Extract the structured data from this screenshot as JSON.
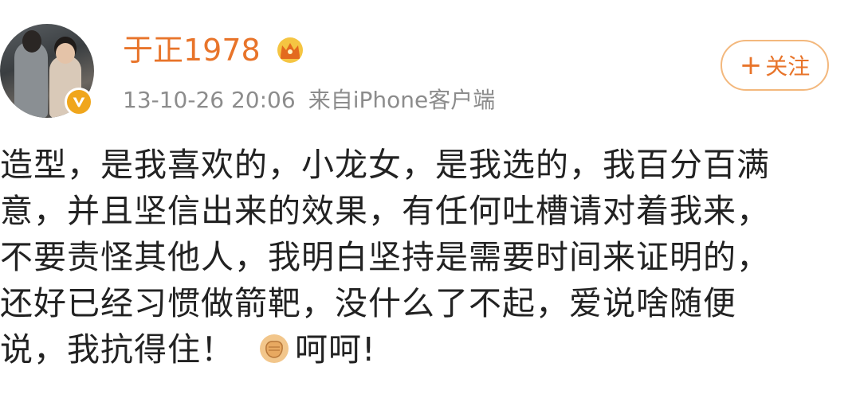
{
  "post": {
    "username": "于正1978",
    "timestamp": "13-10-26 20:06",
    "source": "来自iPhone客户端",
    "follow_label": "关注",
    "follow_prefix": "+",
    "content_lines": [
      "造型，是我喜欢的，小龙女，是我选的，我百分百满",
      "意，并且坚信出来的效果，有任何吐槽请对着我来，",
      "不要责怪其他人，我明白坚持是需要时间来证明的，",
      "还好已经习惯做箭靶，没什么了不起，爱说啥随便",
      "说，我抗得住！"
    ],
    "content_tail": "呵呵!",
    "emoji": "fist-emoji-icon"
  },
  "colors": {
    "accent": "#e8742a",
    "meta": "#8c8c8c",
    "follow_border": "#f3b87d",
    "badge": "#f0a61c"
  }
}
